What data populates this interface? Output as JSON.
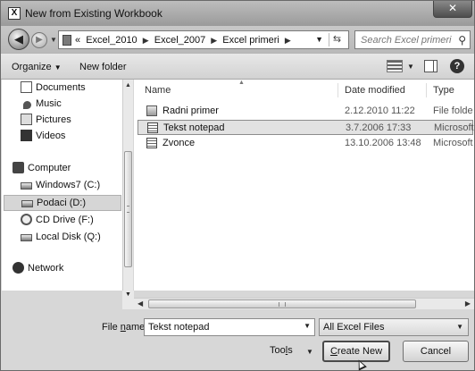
{
  "window": {
    "title": "New from Existing Workbook",
    "close_label": "✕"
  },
  "address": {
    "crumbs": [
      "«",
      "Excel_2010",
      "Excel_2007",
      "Excel primeri"
    ],
    "search_placeholder": "Search Excel primeri"
  },
  "toolbar": {
    "organize": "Organize",
    "new_folder": "New folder",
    "help": "?"
  },
  "nav": {
    "items": [
      {
        "label": "Documents",
        "icon": "documents-icon"
      },
      {
        "label": "Music",
        "icon": "music-icon"
      },
      {
        "label": "Pictures",
        "icon": "pictures-icon"
      },
      {
        "label": "Videos",
        "icon": "videos-icon"
      },
      {
        "label": "Computer",
        "icon": "computer-icon"
      },
      {
        "label": "Windows7 (C:)",
        "icon": "drive-icon"
      },
      {
        "label": "Podaci (D:)",
        "icon": "drive-icon",
        "selected": true
      },
      {
        "label": "CD Drive (F:)",
        "icon": "cd-drive-icon"
      },
      {
        "label": "Local Disk (Q:)",
        "icon": "drive-icon"
      },
      {
        "label": "Network",
        "icon": "network-icon"
      }
    ]
  },
  "files": {
    "columns": {
      "name": "Name",
      "date": "Date modified",
      "type": "Type"
    },
    "rows": [
      {
        "name": "Radni primer",
        "date": "2.12.2010 11:22",
        "type": "File folde",
        "icon": "folder-icon"
      },
      {
        "name": "Tekst notepad",
        "date": "3.7.2006 17:33",
        "type": "Microsoft",
        "icon": "excel-file-icon",
        "selected": true
      },
      {
        "name": "Zvonce",
        "date": "13.10.2006 13:48",
        "type": "Microsoft",
        "icon": "excel-file-icon"
      }
    ]
  },
  "scroll": {
    "grip": "III"
  },
  "bottom": {
    "file_name_label_pre": "File ",
    "file_name_label_u": "n",
    "file_name_label_post": "ame:",
    "file_name_value": "Tekst notepad",
    "file_type": "All Excel Files",
    "tools_pre": "Too",
    "tools_u": "l",
    "tools_post": "s",
    "create_pre": "",
    "create_u": "C",
    "create_post": "reate New",
    "cancel": "Cancel"
  }
}
